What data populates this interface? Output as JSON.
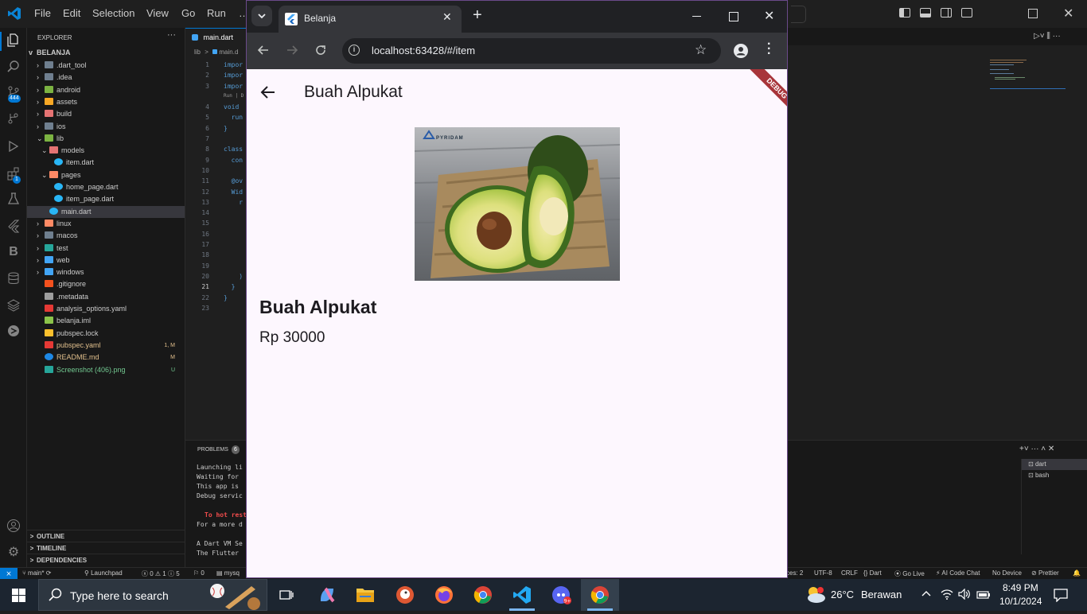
{
  "vscode": {
    "menu": [
      "File",
      "Edit",
      "Selection",
      "View",
      "Go",
      "Run",
      "…"
    ],
    "explorer_title": "EXPLORER",
    "project": "BELANJA",
    "tree": [
      {
        "label": ".dart_tool",
        "depth": 1,
        "type": "folder",
        "chev": ">"
      },
      {
        "label": ".idea",
        "depth": 1,
        "type": "folder",
        "chev": ">"
      },
      {
        "label": "android",
        "depth": 1,
        "type": "folder-green",
        "chev": ">"
      },
      {
        "label": "assets",
        "depth": 1,
        "type": "folder-yellow",
        "chev": ">"
      },
      {
        "label": "build",
        "depth": 1,
        "type": "folder-red",
        "chev": ">"
      },
      {
        "label": "ios",
        "depth": 1,
        "type": "folder",
        "chev": ">"
      },
      {
        "label": "lib",
        "depth": 1,
        "type": "folder-green",
        "chev": "v"
      },
      {
        "label": "models",
        "depth": 2,
        "type": "folder-red",
        "chev": "v"
      },
      {
        "label": "item.dart",
        "depth": 3,
        "type": "dart",
        "chev": ""
      },
      {
        "label": "pages",
        "depth": 2,
        "type": "folder-orange",
        "chev": "v"
      },
      {
        "label": "home_page.dart",
        "depth": 3,
        "type": "dart",
        "chev": ""
      },
      {
        "label": "item_page.dart",
        "depth": 3,
        "type": "dart",
        "chev": ""
      },
      {
        "label": "main.dart",
        "depth": 2,
        "type": "dart",
        "chev": "",
        "selected": true
      },
      {
        "label": "linux",
        "depth": 1,
        "type": "folder-orange",
        "chev": ">"
      },
      {
        "label": "macos",
        "depth": 1,
        "type": "folder",
        "chev": ">"
      },
      {
        "label": "test",
        "depth": 1,
        "type": "folder-teal",
        "chev": ">"
      },
      {
        "label": "web",
        "depth": 1,
        "type": "folder-blue",
        "chev": ">"
      },
      {
        "label": "windows",
        "depth": 1,
        "type": "folder-blue",
        "chev": ">"
      },
      {
        "label": ".gitignore",
        "depth": 1,
        "type": "git",
        "chev": ""
      },
      {
        "label": ".metadata",
        "depth": 1,
        "type": "file",
        "chev": ""
      },
      {
        "label": "analysis_options.yaml",
        "depth": 1,
        "type": "yaml",
        "chev": ""
      },
      {
        "label": "belanja.iml",
        "depth": 1,
        "type": "iml",
        "chev": ""
      },
      {
        "label": "pubspec.lock",
        "depth": 1,
        "type": "lock",
        "chev": ""
      },
      {
        "label": "pubspec.yaml",
        "depth": 1,
        "type": "yaml",
        "chev": "",
        "badge": "1, M",
        "color": "#e2c08d"
      },
      {
        "label": "README.md",
        "depth": 1,
        "type": "info",
        "chev": "",
        "badge": "M",
        "color": "#e2c08d"
      },
      {
        "label": "Screenshot (406).png",
        "depth": 1,
        "type": "img",
        "chev": "",
        "badge": "U",
        "color": "#73c991"
      }
    ],
    "sections": [
      "OUTLINE",
      "TIMELINE",
      "DEPENDENCIES"
    ],
    "editor_tab": "main.dart",
    "breadcrumb": [
      "lib",
      ">",
      "main.d"
    ],
    "line_numbers": [
      "1",
      "2",
      "3",
      "",
      "4",
      "5",
      "6",
      "7",
      "8",
      "9",
      "10",
      "11",
      "12",
      "13",
      "14",
      "15",
      "16",
      "17",
      "18",
      "19",
      "20",
      "21",
      "22",
      "23"
    ],
    "code_lines": [
      "impor",
      "impor",
      "impor",
      "Run | D",
      "void",
      "  run",
      "}",
      "",
      "class",
      "  con",
      "",
      "  @ov",
      "  Wid",
      "    r",
      "",
      "",
      "",
      "",
      "",
      "",
      "    )",
      "  }",
      "}"
    ],
    "panel_tab": "PROBLEMS",
    "panel_badge": "6",
    "terminal_lines": [
      "Launching li",
      "Waiting for",
      "This app is",
      "Debug servic",
      "",
      "To hot rest",
      "For a more d",
      "",
      "A Dart VM Se",
      "The Flutter"
    ],
    "terminal_list": [
      "dart",
      "bash"
    ],
    "status": {
      "branch": "main*",
      "launchpad": "Launchpad",
      "problems": "0 ⚠ 1 ⓘ 5",
      "ports": "0",
      "db": "mysq",
      "spaces": "ces: 2",
      "encoding": "UTF-8",
      "eol": "CRLF",
      "lang": "Dart",
      "golive": "Go Live",
      "ai": "AI Code Chat",
      "device": "No Device",
      "prettier": "Prettier"
    },
    "badges": {
      "source_control": "444",
      "extensions": "1"
    }
  },
  "chrome": {
    "tab_title": "Belanja",
    "url": "localhost:63428/#/item",
    "debug_banner": "DEBUG"
  },
  "app": {
    "appbar_title": "Buah Alpukat",
    "image_logo": "PYRIDAM",
    "item_name": "Buah Alpukat",
    "item_price": "Rp 30000"
  },
  "taskbar": {
    "search_placeholder": "Type here to search",
    "weather_temp": "26°C",
    "weather_desc": "Berawan",
    "time": "8:49 PM",
    "date": "10/1/2024"
  },
  "colors": {
    "vscode_accent": "#0078d4",
    "app_bg": "#fdf7fe",
    "debug_ribbon": "#b13b3b"
  }
}
